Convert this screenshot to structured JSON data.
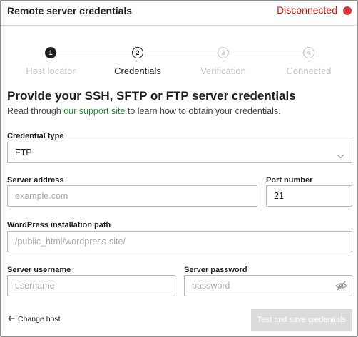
{
  "header": {
    "title": "Remote server credentials",
    "status": "Disconnected",
    "status_color": "#d63638"
  },
  "stepper": {
    "current_step": 2,
    "steps": [
      {
        "number": "1",
        "label": "Host locator",
        "state": "done"
      },
      {
        "number": "2",
        "label": "Credentials",
        "state": "current"
      },
      {
        "number": "3",
        "label": "Verification",
        "state": "upcoming"
      },
      {
        "number": "4",
        "label": "Connected",
        "state": "upcoming"
      }
    ]
  },
  "main": {
    "heading": "Provide your SSH, SFTP or FTP server credentials",
    "intro_before": "Read through ",
    "intro_link": "our support site",
    "intro_after": " to learn how to obtain your credentials.",
    "link_color": "#1e8a3a"
  },
  "form": {
    "credential_type": {
      "label": "Credential type",
      "value": "FTP",
      "icon": "chevron-down-icon"
    },
    "server_address": {
      "label": "Server address",
      "value": "",
      "placeholder": "example.com"
    },
    "port_number": {
      "label": "Port number",
      "value": "21"
    },
    "wp_path": {
      "label": "WordPress installation path",
      "value": "",
      "placeholder": "/public_html/wordpress-site/"
    },
    "username": {
      "label": "Server username",
      "value": "",
      "placeholder": "username"
    },
    "password": {
      "label": "Server password",
      "value": "",
      "placeholder": "password",
      "icon": "eye-slash-icon"
    }
  },
  "footer": {
    "back_label": "Change host",
    "back_icon": "arrow-left-icon",
    "submit_label": "Test and save credentials",
    "submit_enabled": false
  }
}
